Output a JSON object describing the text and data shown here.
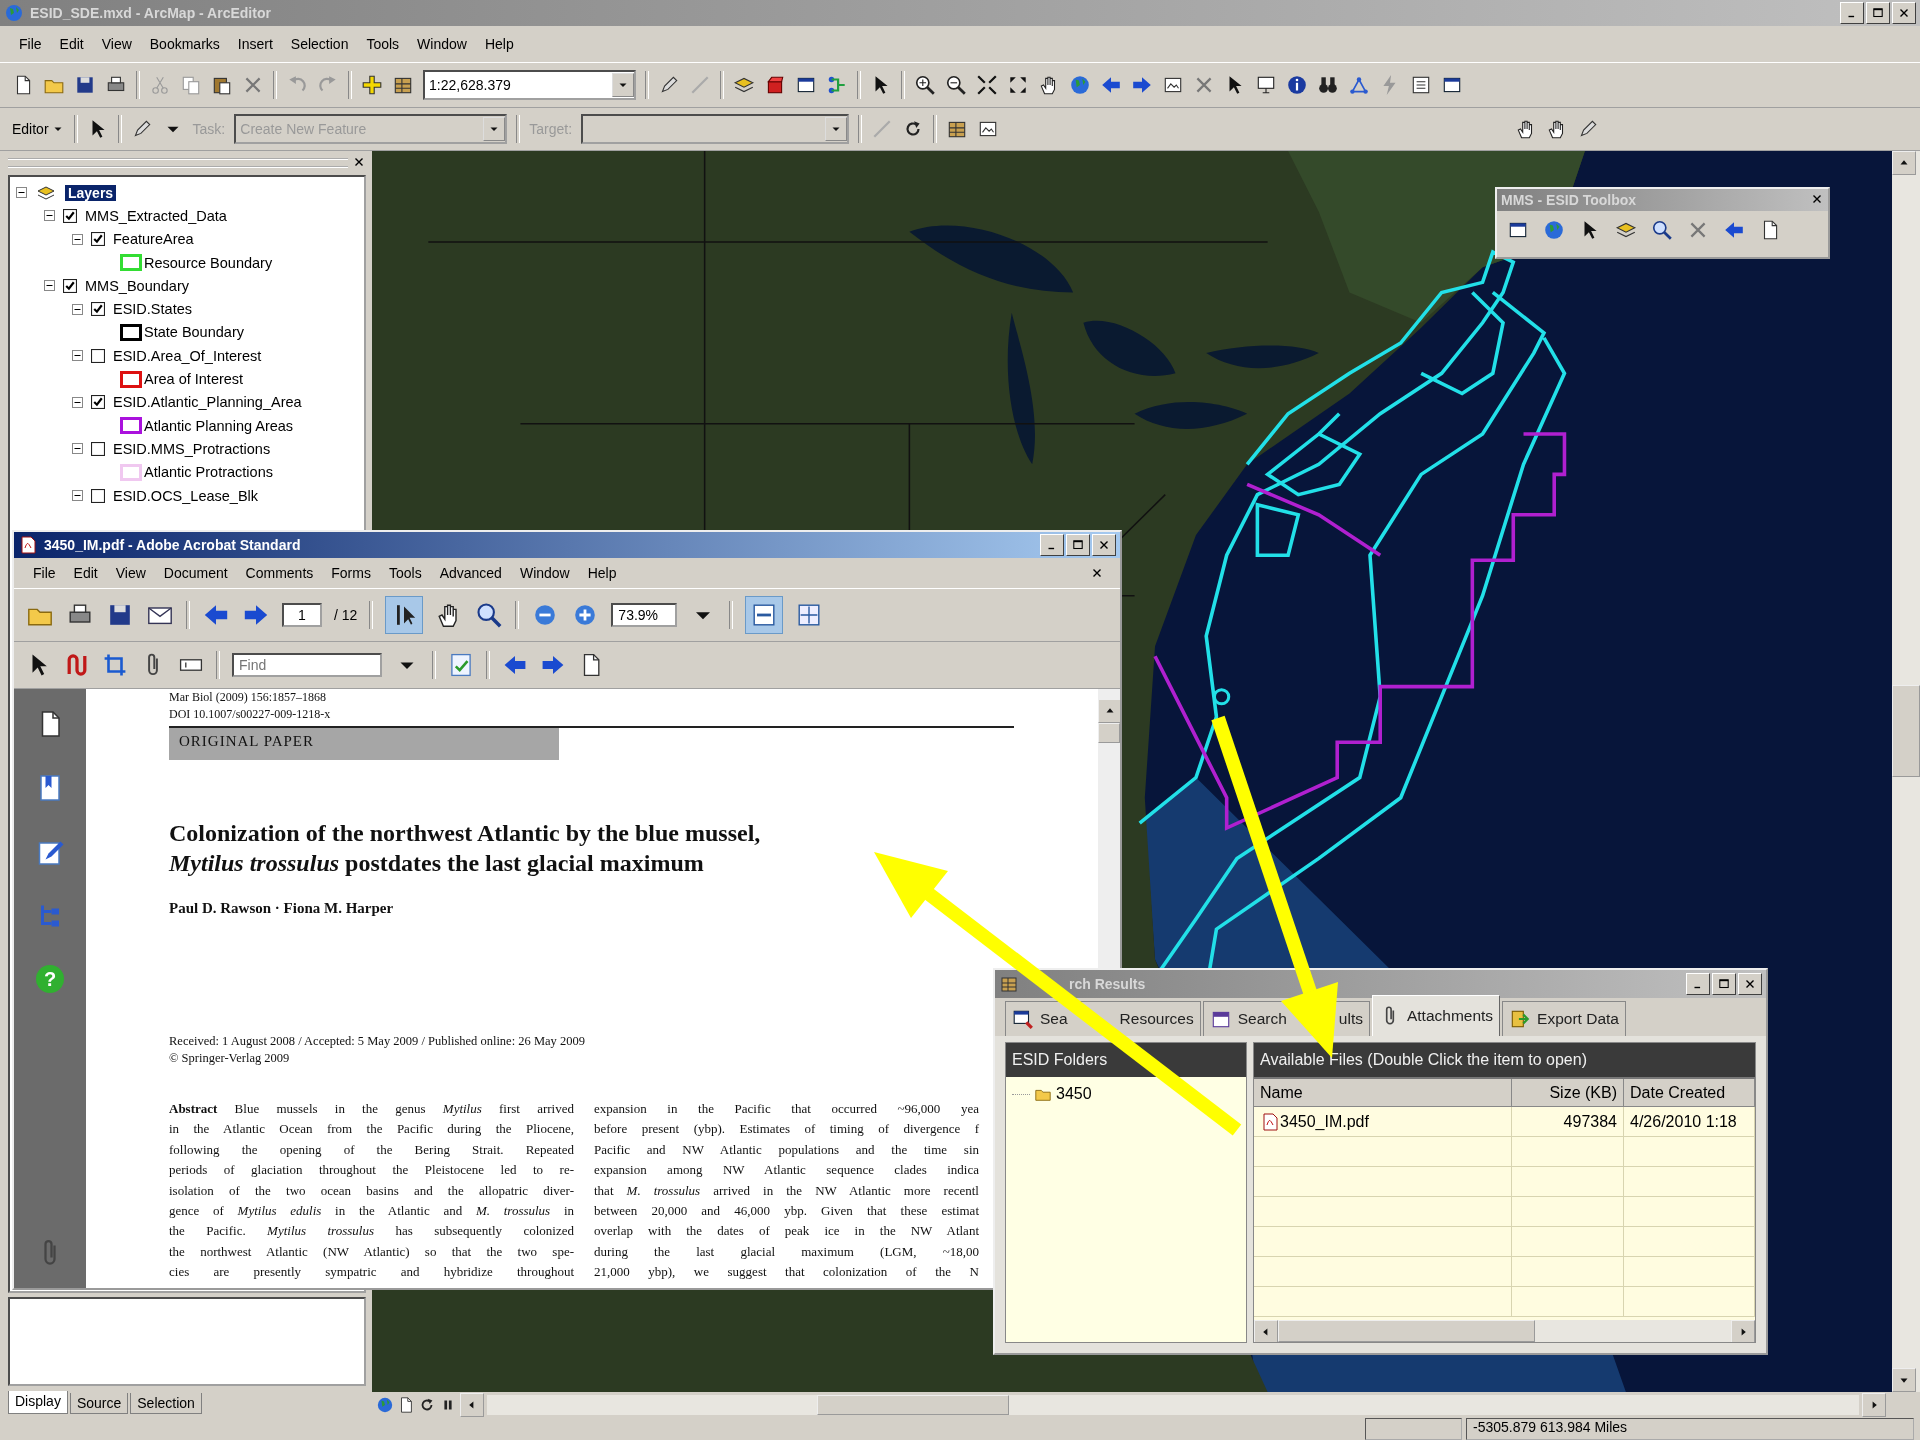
{
  "arcmap": {
    "title": "ESID_SDE.mxd - ArcMap - ArcEditor",
    "menu": [
      "File",
      "Edit",
      "View",
      "Bookmarks",
      "Insert",
      "Selection",
      "Tools",
      "Window",
      "Help"
    ],
    "scale": "1:22,628.379",
    "editor": {
      "label": "Editor",
      "task_label": "Task:",
      "task": "Create New Feature",
      "target_label": "Target:"
    },
    "toc": {
      "label": "Layers",
      "selected": true,
      "expanded": true,
      "children": [
        {
          "kind": "layer",
          "label": "MMS_Extracted_Data",
          "checked": true,
          "expanded": true,
          "children": [
            {
              "kind": "layer",
              "label": "FeatureArea",
              "checked": true,
              "expanded": true,
              "children": [
                {
                  "kind": "legend",
                  "label": "Resource Boundary",
                  "color": "#33dd33"
                }
              ]
            }
          ]
        },
        {
          "kind": "layer",
          "label": "MMS_Boundary",
          "checked": true,
          "expanded": true,
          "children": [
            {
              "kind": "layer",
              "label": "ESID.States",
              "checked": true,
              "expanded": true,
              "children": [
                {
                  "kind": "legend",
                  "label": "State Boundary",
                  "color": "#000000"
                }
              ]
            },
            {
              "kind": "layer",
              "label": "ESID.Area_Of_Interest",
              "checked": false,
              "expanded": true,
              "children": [
                {
                  "kind": "legend",
                  "label": "Area of Interest",
                  "color": "#dd1111"
                }
              ]
            },
            {
              "kind": "layer",
              "label": "ESID.Atlantic_Planning_Area",
              "checked": true,
              "expanded": true,
              "children": [
                {
                  "kind": "legend",
                  "label": "Atlantic Planning Areas",
                  "color": "#aa11dd"
                }
              ]
            },
            {
              "kind": "layer",
              "label": "ESID.MMS_Protractions",
              "checked": false,
              "expanded": true,
              "children": [
                {
                  "kind": "legend",
                  "label": "Atlantic Protractions",
                  "color": "#f0c8f0"
                }
              ]
            },
            {
              "kind": "layer",
              "label": "ESID.OCS_Lease_Blk",
              "checked": false,
              "expanded": true
            }
          ]
        }
      ]
    },
    "toc_tabs": [
      {
        "label": "Display",
        "selected": true
      },
      {
        "label": "Source",
        "selected": false
      },
      {
        "label": "Selection",
        "selected": false
      }
    ],
    "status": "-5305.879  613.984 Miles"
  },
  "toolbox": {
    "title": "MMS - ESID Toolbox"
  },
  "acrobat": {
    "title": "3450_IM.pdf - Adobe Acrobat Standard",
    "menu": [
      "File",
      "Edit",
      "View",
      "Document",
      "Comments",
      "Forms",
      "Tools",
      "Advanced",
      "Window",
      "Help"
    ],
    "page": "1",
    "page_count": "/ 12",
    "zoom": "73.9%",
    "find_placeholder": "Find",
    "help_glyph": "?",
    "document": {
      "journal": "Mar Biol (2009) 156:1857–1868",
      "doi": "DOI 10.1007/s00227-009-1218-x",
      "section": "ORIGINAL PAPER",
      "title_lines": [
        "Colonization of the northwest Atlantic by the blue mussel,",
        "*Mytilus trossulus* postdates the last glacial maximum"
      ],
      "authors": "Paul D. Rawson · Fiona M. Harper",
      "received": "Received: 1 August 2008 / Accepted: 5 May 2009 / Published online: 26 May 2009",
      "copyright": "© Springer-Verlag 2009",
      "abstract_left": [
        "**Abstract** Blue mussels in the genus *Mytilus* first arrived",
        "in the Atlantic Ocean from the Pacific during the Pliocene,",
        "following the opening of the Bering Strait. Repeated",
        "periods of glaciation throughout the Pleistocene led to re-",
        "isolation of the two ocean basins and the allopatric diver-",
        "gence of *Mytilus edulis* in the Atlantic and *M. trossulus* in",
        "the Pacific. *Mytilus trossulus* has subsequently colonized",
        "the northwest Atlantic (NW Atlantic) so that the two spe-",
        "cies are presently sympatric and hybridize throughout"
      ],
      "abstract_right": [
        "expansion in the Pacific that occurred ~96,000 yea",
        "before present (ybp). Estimates of timing of divergence f",
        "Pacific and NW Atlantic populations and the time sin",
        "expansion among NW Atlantic sequence clades indica",
        "that *M. trossulus* arrived in the NW Atlantic more recentl",
        "between 20,000 and 46,000 ybp. Given that these estimat",
        "overlap with the dates of peak ice in the NW Atlant",
        "during the last glacial maximum (LGM, ~18,00",
        "21,000 ybp), we suggest that colonization of the N"
      ]
    }
  },
  "search": {
    "title": "rch Results",
    "tabs": [
      {
        "label": [
          "Sea",
          "Resources"
        ],
        "selected": false
      },
      {
        "label": [
          "Search",
          "ults"
        ],
        "selected": false
      },
      {
        "label": [
          "Attachments"
        ],
        "selected": true
      },
      {
        "label": [
          "Export Data"
        ],
        "selected": false
      }
    ],
    "folders_header": "ESID Folders",
    "folders": [
      "3450"
    ],
    "files_header": "Available Files (Double Click the item to open)",
    "columns": [
      "Name",
      "Size (KB)",
      "Date Created"
    ],
    "rows": [
      [
        "3450_IM.pdf",
        "497384",
        "4/26/2010 1:18"
      ]
    ]
  }
}
